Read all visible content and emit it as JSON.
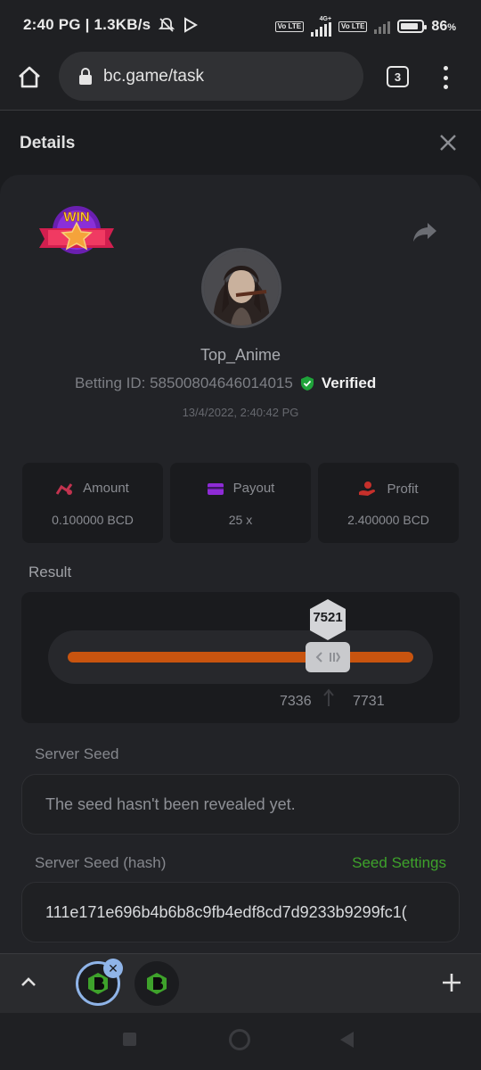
{
  "status_bar": {
    "time_speed": "2:40 PG | 1.3KB/s",
    "network_type": "4G+",
    "battery": "86",
    "battery_unit": "%",
    "volte_label": "Vo LTE",
    "battery_level": 0.86
  },
  "browser": {
    "url": "bc.game/task",
    "tab_count": "3",
    "icons": [
      "home-icon",
      "lock-icon",
      "tab-switcher",
      "overflow-menu-icon"
    ]
  },
  "details": {
    "title": "Details",
    "badge_text": "WIN",
    "username": "Top_Anime",
    "betting_id": "Betting ID: 58500804646014015",
    "verified_label": "Verified",
    "date": "13/4/2022, 2:40:42 PG"
  },
  "stats": [
    {
      "label": "Amount",
      "value": "0.100000 BCD",
      "icon": "amount-icon",
      "color": "#c2334f"
    },
    {
      "label": "Payout",
      "value": "25 x",
      "icon": "wallet-icon",
      "color": "#8e2bd6"
    },
    {
      "label": "Profit",
      "value": "2.400000 BCD",
      "icon": "profit-icon",
      "color": "#c6302b"
    }
  ],
  "result": {
    "label": "Result",
    "value": "7521",
    "range_low": "7336",
    "range_high": "7731",
    "bar_color": "#c8540f"
  },
  "server_seed": {
    "label": "Server Seed",
    "value": "The seed hasn't been revealed yet."
  },
  "server_seed_hash": {
    "label": "Server Seed (hash)",
    "settings_label": "Seed Settings",
    "value": "111e171e696b4b6b8c9fb4edf8cd7d9233b9299fc1(",
    "accent": "#3ea22b"
  },
  "colors": {
    "verified": "#1fa33a",
    "background": "#1b1c1f",
    "card": "#222327"
  }
}
